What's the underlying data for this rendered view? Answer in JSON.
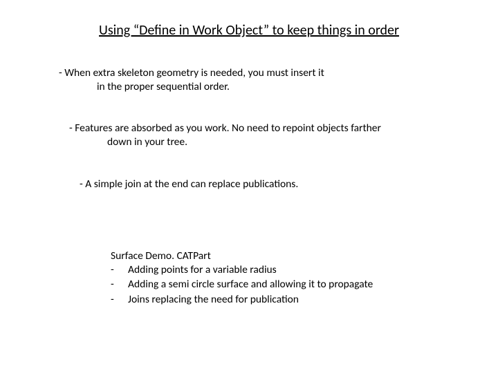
{
  "title": "Using “Define in Work Object” to keep things in order",
  "bullets": {
    "b1_line1": "- When extra skeleton geometry is needed, you must insert it",
    "b1_line2": "in the proper sequential order.",
    "b2_line1": "- Features are absorbed as you work. No need to repoint objects farther",
    "b2_line2": "down in your tree.",
    "b3": "- A simple join at the end can replace publications."
  },
  "section": {
    "heading": "Surface Demo. CATPart",
    "items": [
      "Adding points for a variable radius",
      "Adding a semi circle surface and allowing it to propagate",
      "Joins replacing the need for publication"
    ]
  },
  "dash": "-"
}
